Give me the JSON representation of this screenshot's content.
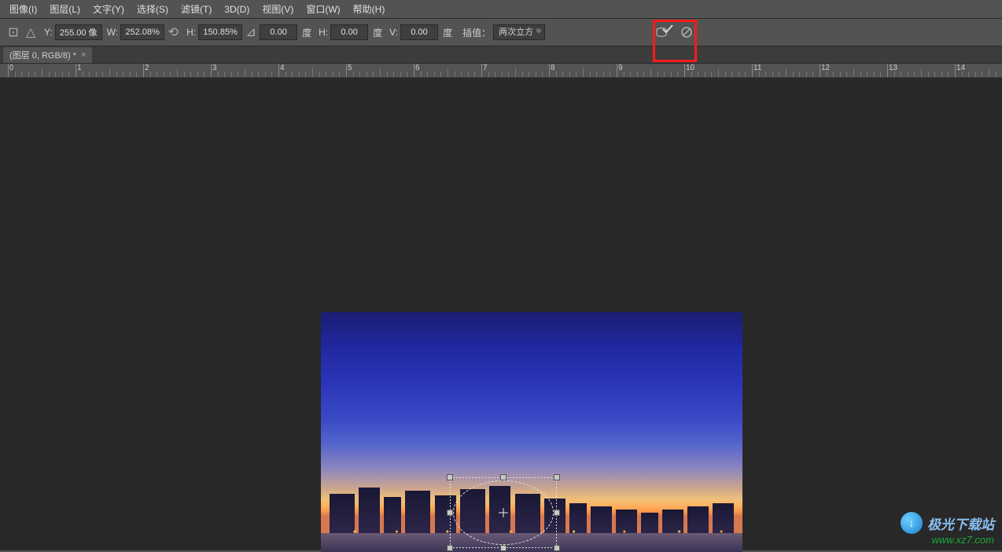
{
  "menu": {
    "image": "图像(I)",
    "layer": "图层(L)",
    "type": "文字(Y)",
    "select": "选择(S)",
    "filter": "滤镜(T)",
    "threeD": "3D(D)",
    "view": "视图(V)",
    "window": "窗口(W)",
    "help": "帮助(H)"
  },
  "options": {
    "y_label": "Y:",
    "y_value": "255.00 像",
    "w_label": "W:",
    "w_value": "252.08%",
    "h_label": "H:",
    "h_value": "150.85%",
    "angle_value": "0.00",
    "angle_unit": "度",
    "h2_label": "H:",
    "h2_value": "0.00",
    "h2_unit": "度",
    "v_label": "V:",
    "v_value": "0.00",
    "v_unit": "度",
    "interp_label": "插值：",
    "interp_value": "两次立方"
  },
  "tab": {
    "title": "(图层 0, RGB/8) *"
  },
  "ruler": {
    "start": 0,
    "end": 14
  },
  "watermark": {
    "title": "极光下载站",
    "url": "www.xz7.com"
  }
}
